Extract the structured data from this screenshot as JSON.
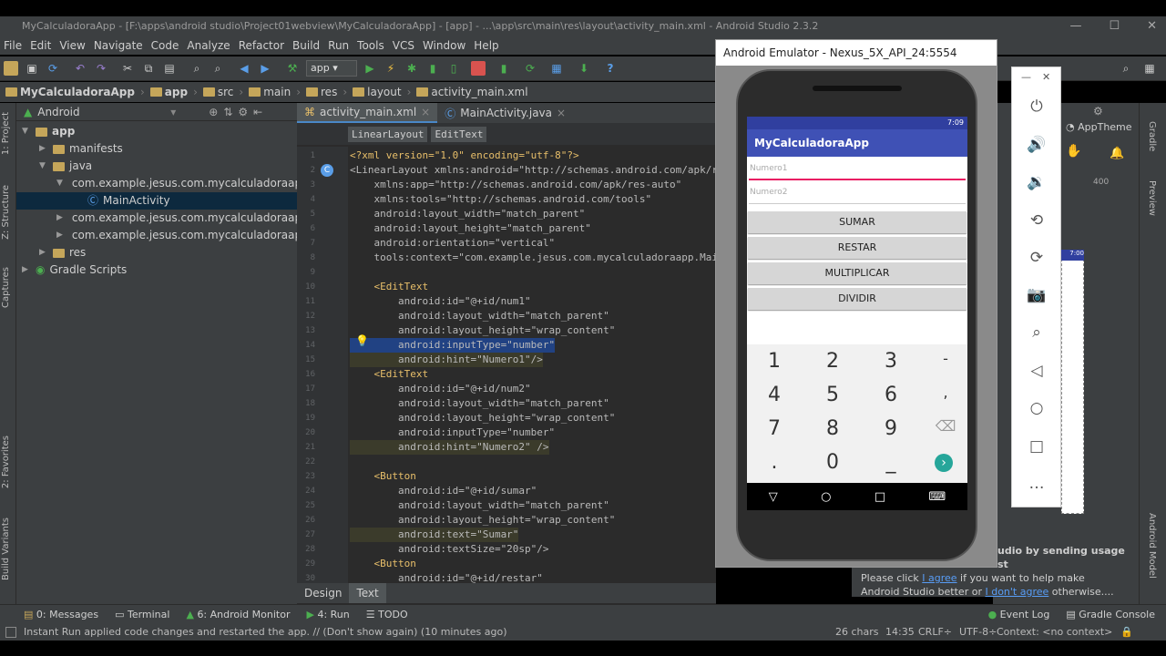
{
  "window": {
    "title": "MyCalculadoraApp - [F:\\apps\\android studio\\Project01webview\\MyCalculadoraApp] - [app] - ...\\app\\src\\main\\res\\layout\\activity_main.xml - Android Studio 2.3.2"
  },
  "menu": [
    "File",
    "Edit",
    "View",
    "Navigate",
    "Code",
    "Analyze",
    "Refactor",
    "Build",
    "Run",
    "Tools",
    "VCS",
    "Window",
    "Help"
  ],
  "toolbar": {
    "config": "app"
  },
  "breadcrumb": [
    "MyCalculadoraApp",
    "app",
    "src",
    "main",
    "res",
    "layout",
    "activity_main.xml"
  ],
  "project": {
    "view": "Android",
    "tree": [
      {
        "label": "app",
        "depth": 0,
        "arrow": "▼"
      },
      {
        "label": "manifests",
        "depth": 1,
        "arrow": "▶"
      },
      {
        "label": "java",
        "depth": 1,
        "arrow": "▼"
      },
      {
        "label": "com.example.jesus.com.mycalculadoraapp",
        "depth": 2,
        "arrow": "▼"
      },
      {
        "label": "MainActivity",
        "depth": 3,
        "arrow": ""
      },
      {
        "label": "com.example.jesus.com.mycalculadoraapp (ar",
        "depth": 2,
        "arrow": "▶"
      },
      {
        "label": "com.example.jesus.com.mycalculadoraapp (te",
        "depth": 2,
        "arrow": "▶"
      },
      {
        "label": "res",
        "depth": 1,
        "arrow": "▶"
      },
      {
        "label": "Gradle Scripts",
        "depth": 0,
        "arrow": "▶"
      }
    ]
  },
  "left_tabs": [
    "1: Project",
    "Z: Structure",
    "Captures",
    "2: Favorites",
    "Build Variants"
  ],
  "editor": {
    "tabs": [
      "activity_main.xml",
      "MainActivity.java"
    ],
    "crumbs": [
      "LinearLayout",
      "EditText"
    ],
    "bottom_tabs": [
      "Design",
      "Text"
    ],
    "lines": [
      {
        "n": "1",
        "t": "<?xml version=\"1.0\" encoding=\"utf-8\"?>"
      },
      {
        "n": "2",
        "t": "<LinearLayout xmlns:android=\"http://schemas.android.com/apk/r"
      },
      {
        "n": "3",
        "t": "    xmlns:app=\"http://schemas.android.com/apk/res-auto\""
      },
      {
        "n": "4",
        "t": "    xmlns:tools=\"http://schemas.android.com/tools\""
      },
      {
        "n": "5",
        "t": "    android:layout_width=\"match_parent\""
      },
      {
        "n": "6",
        "t": "    android:layout_height=\"match_parent\""
      },
      {
        "n": "7",
        "t": "    android:orientation=\"vertical\""
      },
      {
        "n": "8",
        "t": "    tools:context=\"com.example.jesus.com.mycalculadoraapp.Mai"
      },
      {
        "n": "9",
        "t": ""
      },
      {
        "n": "10",
        "t": "    <EditText"
      },
      {
        "n": "11",
        "t": "        android:id=\"@+id/num1\""
      },
      {
        "n": "12",
        "t": "        android:layout_width=\"match_parent\""
      },
      {
        "n": "13",
        "t": "        android:layout_height=\"wrap_content\""
      },
      {
        "n": "14",
        "t": "        android:inputType=\"number\""
      },
      {
        "n": "15",
        "t": "        android:hint=\"Numero1\"/>"
      },
      {
        "n": "16",
        "t": "    <EditText"
      },
      {
        "n": "17",
        "t": "        android:id=\"@+id/num2\""
      },
      {
        "n": "18",
        "t": "        android:layout_width=\"match_parent\""
      },
      {
        "n": "19",
        "t": "        android:layout_height=\"wrap_content\""
      },
      {
        "n": "20",
        "t": "        android:inputType=\"number\""
      },
      {
        "n": "21",
        "t": "        android:hint=\"Numero2\" />"
      },
      {
        "n": "22",
        "t": ""
      },
      {
        "n": "23",
        "t": "    <Button"
      },
      {
        "n": "24",
        "t": "        android:id=\"@+id/sumar\""
      },
      {
        "n": "25",
        "t": "        android:layout_width=\"match_parent\""
      },
      {
        "n": "26",
        "t": "        android:layout_height=\"wrap_content\""
      },
      {
        "n": "27",
        "t": "        android:text=\"Sumar\""
      },
      {
        "n": "28",
        "t": "        android:textSize=\"20sp\"/>"
      },
      {
        "n": "29",
        "t": "    <Button"
      },
      {
        "n": "30",
        "t": "        android:id=\"@+id/restar\""
      }
    ]
  },
  "emulator": {
    "title": "Android Emulator - Nexus_5X_API_24:5554",
    "time": "7:09",
    "app_title": "MyCalculadoraApp",
    "hint1": "Numero1",
    "hint2": "Numero2",
    "buttons": [
      "SUMAR",
      "RESTAR",
      "MULTIPLICAR",
      "DIVIDIR"
    ],
    "keys": [
      "1",
      "2",
      "3",
      "-",
      "4",
      "5",
      "6",
      ",",
      "7",
      "8",
      "9",
      "⌫",
      ".",
      "0",
      "_",
      "›"
    ]
  },
  "right_panel": {
    "theme": "AppTheme",
    "ruler": "400",
    "preview_time": "7:00"
  },
  "right_tabs": [
    "Gradle",
    "Preview",
    "Android Model"
  ],
  "notice": {
    "heading": "udio by sending usage st",
    "line1_pre": "Please click ",
    "agree": "I agree",
    "line1_post": " if you want to help make",
    "line2_pre": "Android Studio better or ",
    "disagree": "I don't agree",
    "line2_post": " otherwise...."
  },
  "bottom_tabs": [
    "0: Messages",
    "Terminal",
    "6: Android Monitor",
    "4: Run",
    "TODO"
  ],
  "bottom_right": [
    "Event Log",
    "Gradle Console"
  ],
  "status": {
    "message": "Instant Run applied code changes and restarted the app. // (Don't show again) (10 minutes ago)",
    "chars": "26 chars",
    "pos": "14:35",
    "crlf": "CRLF÷",
    "enc": "UTF-8÷",
    "context": "Context: <no context>"
  }
}
